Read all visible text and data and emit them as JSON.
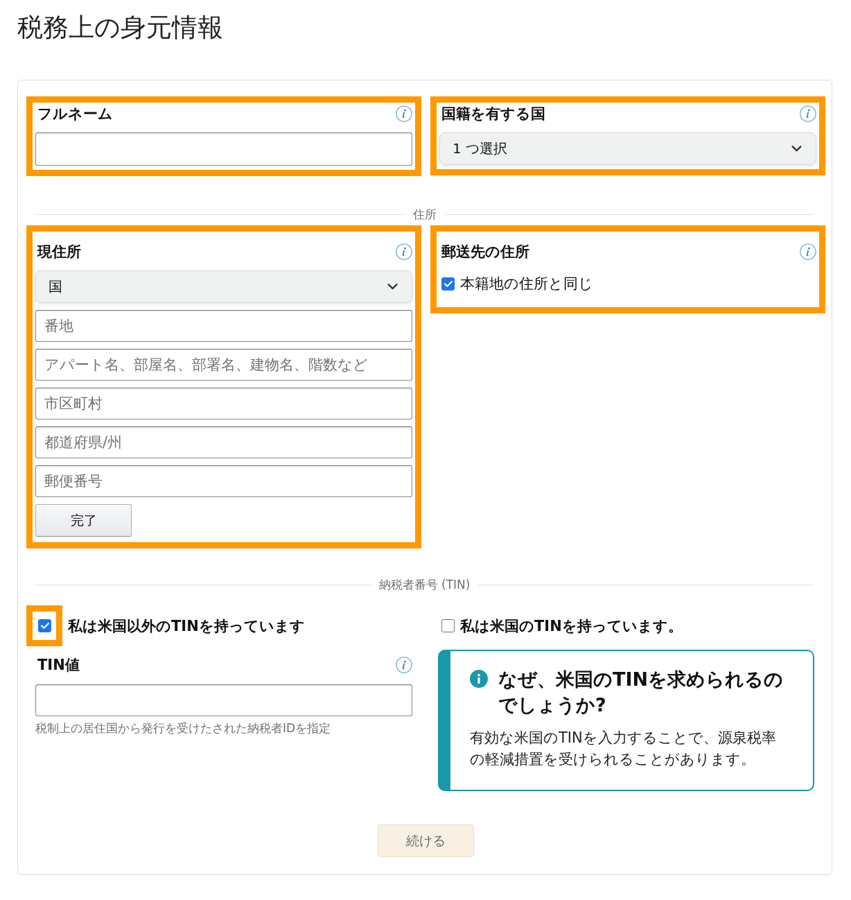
{
  "page_title": "税務上の身元情報",
  "identity_fields": [
    {
      "kind": "text",
      "label": "フルネーム",
      "highlighted": true
    },
    {
      "kind": "select",
      "label": "国籍を有する国",
      "value": "1 つ選択",
      "highlighted": true
    }
  ],
  "address_section": {
    "divider": "住所",
    "current_address": {
      "label": "現住所",
      "highlighted": true,
      "country_select": "国",
      "fields": [
        {
          "placeholder": "番地"
        },
        {
          "placeholder": "アパート名、部屋名、部署名、建物名、階数など"
        },
        {
          "placeholder": "市区町村"
        },
        {
          "placeholder": "都道府県/州"
        },
        {
          "placeholder": "郵便番号"
        }
      ],
      "done_button": "完了"
    },
    "mailing_address": {
      "label": "郵送先の住所",
      "highlighted": true,
      "same_as_permanent": {
        "label": "本籍地の住所と同じ",
        "checked": true
      }
    }
  },
  "tin_section": {
    "divider": "納税者番号 (TIN)",
    "options": [
      {
        "label": "私は米国以外のTINを持っています",
        "checked": true,
        "highlighted": true
      },
      {
        "label": "私は米国のTINを持っています。",
        "checked": false,
        "highlighted": false
      }
    ],
    "tin_value": {
      "label": "TIN値",
      "hint": "税制上の居住国から発行を受けたされた納税者IDを指定"
    },
    "info_box": {
      "title": "なぜ、米国のTINを求められるのでしょうか?",
      "body": "有効な米国のTINを入力することで、源泉税率の軽減措置を受けられることがあります。"
    }
  },
  "continue_button": {
    "label": "続ける",
    "disabled": true
  }
}
